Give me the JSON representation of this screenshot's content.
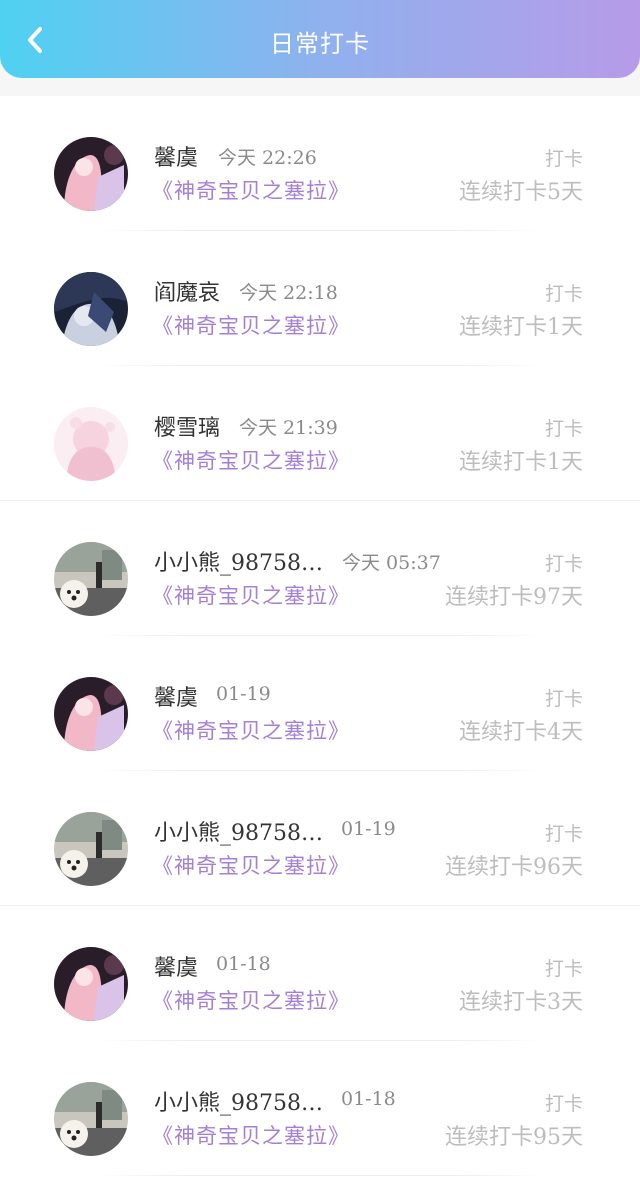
{
  "header": {
    "title": "日常打卡",
    "back_icon": "chevron-left-icon",
    "gradient": [
      "#4fd1f2",
      "#b79be8"
    ]
  },
  "colors": {
    "book_title": "#a47fd6",
    "streak": "#bdbdbd",
    "time": "#8a8a8a"
  },
  "checkins": [
    {
      "name": "馨虞",
      "time": "今天 22:26",
      "book": "《神奇宝贝之塞拉》",
      "tag": "打卡",
      "streak": "连续打卡5天",
      "avatar": "pink-anime-girl"
    },
    {
      "name": "阎魔哀",
      "time": "今天 22:18",
      "book": "《神奇宝贝之塞拉》",
      "tag": "打卡",
      "streak": "连续打卡1天",
      "avatar": "dark-anime-couple"
    },
    {
      "name": "樱雪璃",
      "time": "今天 21:39",
      "book": "《神奇宝贝之塞拉》",
      "tag": "打卡",
      "streak": "连续打卡1天",
      "avatar": "white-pink-anime-girl"
    },
    {
      "name": "小小熊_98758…",
      "time": "今天 05:37",
      "book": "《神奇宝贝之塞拉》",
      "tag": "打卡",
      "streak": "连续打卡97天",
      "avatar": "street-dog-photo"
    },
    {
      "name": "馨虞",
      "time": "01-19",
      "book": "《神奇宝贝之塞拉》",
      "tag": "打卡",
      "streak": "连续打卡4天",
      "avatar": "pink-anime-girl"
    },
    {
      "name": "小小熊_98758…",
      "time": "01-19",
      "book": "《神奇宝贝之塞拉》",
      "tag": "打卡",
      "streak": "连续打卡96天",
      "avatar": "street-dog-photo"
    },
    {
      "name": "馨虞",
      "time": "01-18",
      "book": "《神奇宝贝之塞拉》",
      "tag": "打卡",
      "streak": "连续打卡3天",
      "avatar": "pink-anime-girl"
    },
    {
      "name": "小小熊_98758…",
      "time": "01-18",
      "book": "《神奇宝贝之塞拉》",
      "tag": "打卡",
      "streak": "连续打卡95天",
      "avatar": "street-dog-photo"
    }
  ]
}
